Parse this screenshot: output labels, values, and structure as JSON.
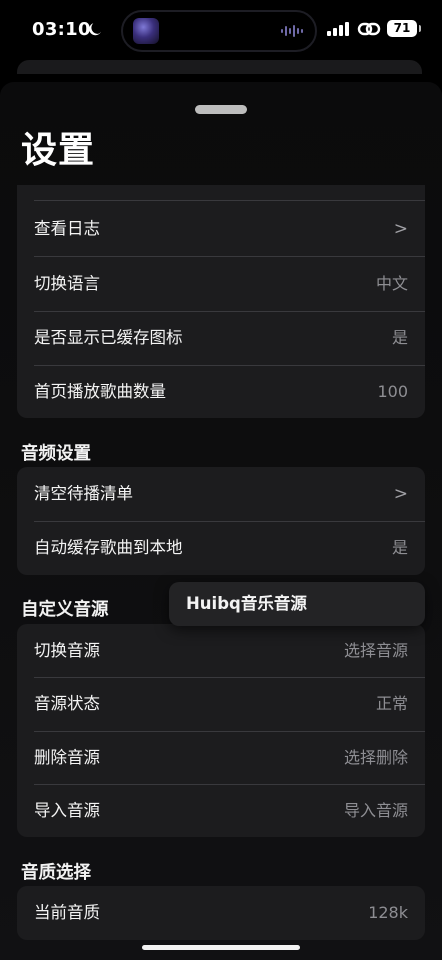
{
  "status_bar": {
    "time": "03:10",
    "battery": "71",
    "icons": [
      "moon-icon",
      "audio-wave-icon",
      "signal-icon",
      "personal-hotspot-icon",
      "battery-icon"
    ]
  },
  "page": {
    "title": "设置"
  },
  "general": {
    "rows": [
      {
        "label": "查看日志",
        "value": ">"
      },
      {
        "label": "切换语言",
        "value": "中文"
      },
      {
        "label": "是否显示已缓存图标",
        "value": "是"
      },
      {
        "label": "首页播放歌曲数量",
        "value": "100"
      }
    ]
  },
  "audio": {
    "header": "音频设置",
    "rows": [
      {
        "label": "清空待播清单",
        "value": ">"
      },
      {
        "label": "自动缓存歌曲到本地",
        "value": "是"
      }
    ]
  },
  "custom_source": {
    "header": "自定义音源",
    "popup": "Huibq音乐音源",
    "rows": [
      {
        "label": "切换音源",
        "value": "选择音源"
      },
      {
        "label": "音源状态",
        "value": "正常"
      },
      {
        "label": "删除音源",
        "value": "选择删除"
      },
      {
        "label": "导入音源",
        "value": "导入音源"
      }
    ]
  },
  "quality": {
    "header": "音质选择",
    "rows": [
      {
        "label": "当前音质",
        "value": "128k"
      }
    ]
  },
  "colors": {
    "background": "#000000",
    "card": "#1c1c1e",
    "secondary_text": "#8e8e93"
  }
}
